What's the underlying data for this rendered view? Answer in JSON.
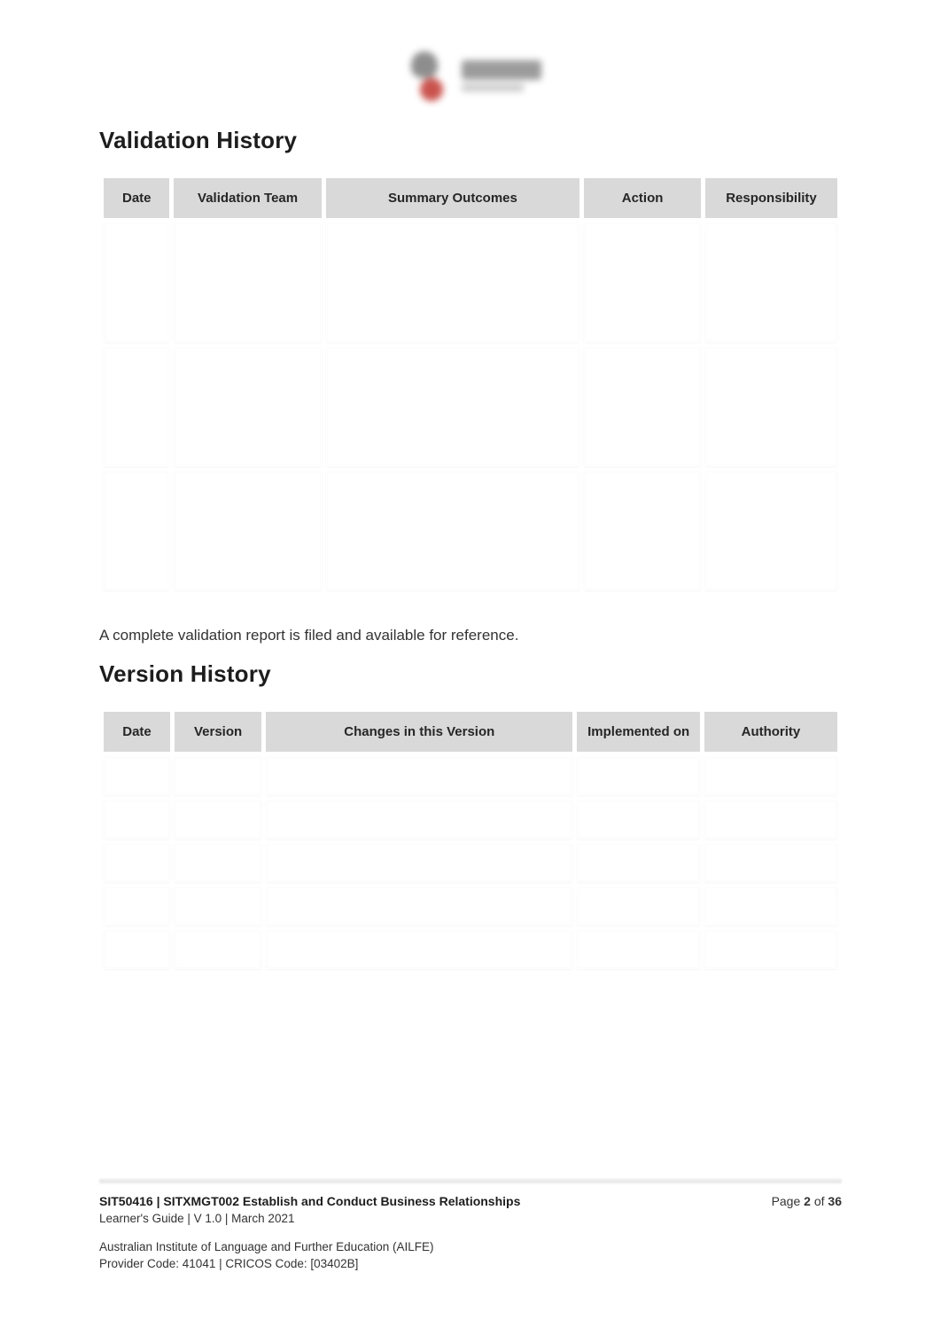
{
  "headings": {
    "validation_history": "Validation History",
    "version_history": "Version History"
  },
  "validation_table": {
    "headers": {
      "date": "Date",
      "team": "Validation Team",
      "summary": "Summary Outcomes",
      "action": "Action",
      "responsibility": "Responsibility"
    },
    "rows": [
      {
        "date": "",
        "team": "",
        "summary": "",
        "action": "",
        "responsibility": ""
      },
      {
        "date": "",
        "team": "",
        "summary": "",
        "action": "",
        "responsibility": ""
      },
      {
        "date": "",
        "team": "",
        "summary": "",
        "action": "",
        "responsibility": ""
      }
    ]
  },
  "note_line": "A complete validation report is filed and available for reference.",
  "version_table": {
    "headers": {
      "date": "Date",
      "version": "Version",
      "changes": "Changes in this Version",
      "implemented": "Implemented on",
      "authority": "Authority"
    },
    "rows": [
      {
        "date": "",
        "version": "",
        "changes": "",
        "implemented": "",
        "authority": ""
      },
      {
        "date": "",
        "version": "",
        "changes": "",
        "implemented": "",
        "authority": ""
      },
      {
        "date": "",
        "version": "",
        "changes": "",
        "implemented": "",
        "authority": ""
      },
      {
        "date": "",
        "version": "",
        "changes": "",
        "implemented": "",
        "authority": ""
      },
      {
        "date": "",
        "version": "",
        "changes": "",
        "implemented": "",
        "authority": ""
      }
    ]
  },
  "footer": {
    "course_line": "SIT50416 | SITXMGT002 Establish and Conduct Business Relationships",
    "guide_line": "Learner's Guide | V 1.0 | March 2021",
    "org_line": "Australian Institute of Language and Further Education (AILFE)",
    "provider_line": "Provider Code: 41041 | CRICOS Code: [03402B]",
    "page_prefix": "Page ",
    "page_current": "2",
    "page_of": " of ",
    "page_total": "36"
  }
}
